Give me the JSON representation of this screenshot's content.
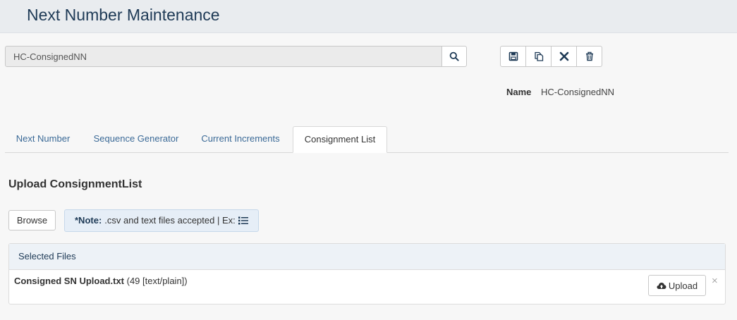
{
  "header": {
    "title": "Next Number Maintenance"
  },
  "search": {
    "value": "HC-ConsignedNN"
  },
  "toolbar": {
    "icons": [
      "save-icon",
      "copy-icon",
      "close-icon",
      "trash-icon"
    ]
  },
  "record": {
    "name_label": "Name",
    "name_value": "HC-ConsignedNN"
  },
  "tabs": [
    {
      "label": "Next Number",
      "active": false
    },
    {
      "label": "Sequence Generator",
      "active": false
    },
    {
      "label": "Current Increments",
      "active": false
    },
    {
      "label": "Consignment List",
      "active": true
    }
  ],
  "upload": {
    "title": "Upload ConsignmentList",
    "browse_label": "Browse",
    "note_strong": "*Note:",
    "note_text": ".csv and text files accepted | Ex:",
    "selected_heading": "Selected Files",
    "file": {
      "name": "Consigned SN Upload.txt",
      "meta": "(49 [text/plain])"
    },
    "upload_label": "Upload",
    "remove_label": "×"
  },
  "colors": {
    "title": "#1e3a56",
    "link": "#3b6a97",
    "note_bg": "#e6eef7"
  }
}
